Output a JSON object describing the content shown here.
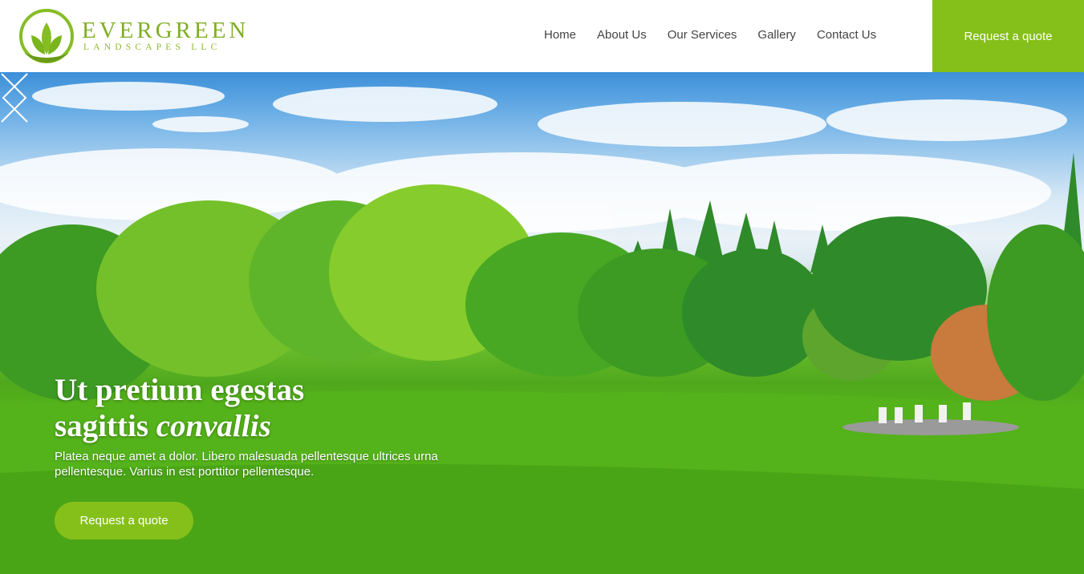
{
  "brand": {
    "name": "EVERGREEN",
    "subtitle": "LANDSCAPES LLC",
    "accent": "#85c01a"
  },
  "nav": {
    "items": [
      {
        "label": "Home"
      },
      {
        "label": "About Us"
      },
      {
        "label": "Our Services"
      },
      {
        "label": "Gallery"
      },
      {
        "label": "Contact Us"
      }
    ],
    "cta_label": "Request a quote"
  },
  "hero": {
    "title_line1": "Ut pretium egestas",
    "title_line2_plain": "sagittis",
    "title_line2_italic": "convallis",
    "text": "Platea neque amet a dolor. Libero malesuada pellentesque ultrices urna pellentesque. Varius in est porttitor pellentesque.",
    "cta_label": "Request a quote",
    "prev_icon": "chevron-left-icon",
    "next_icon": "chevron-right-icon"
  }
}
